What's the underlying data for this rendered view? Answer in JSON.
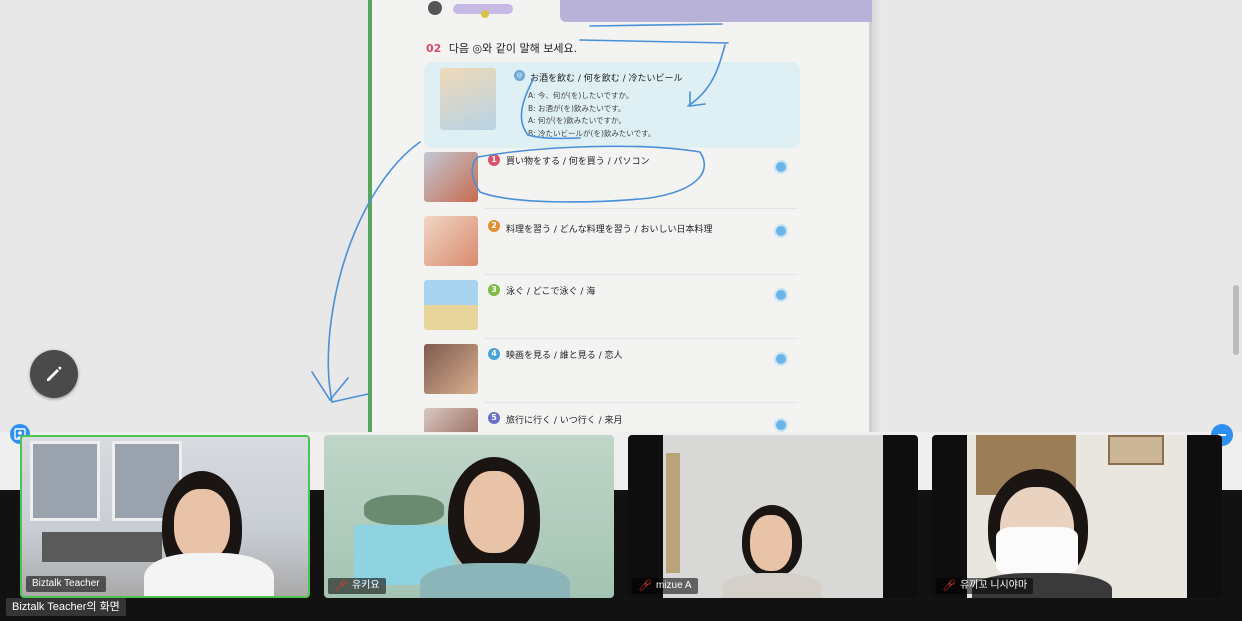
{
  "shared_screen": {
    "exercise": {
      "number": "02",
      "instruction": "다음 ◎와 같이 말해 보세요.",
      "example": {
        "marker": "◎",
        "prompt": "お酒を飲む / 何を飲む / 冷たいビール",
        "lines": [
          "A: 今、何が(を)したいですか。",
          "B: お酒が(を)飲みたいです。",
          "A: 何が(を)飲みたいですか。",
          "B: 冷たいビールが(を)飲みたいです。"
        ]
      },
      "items": [
        {
          "num": "1",
          "text": "買い物をする / 何を買う / パソコン"
        },
        {
          "num": "2",
          "text": "料理を習う / どんな料理を習う / おいしい日本料理"
        },
        {
          "num": "3",
          "text": "泳ぐ / どこで泳ぐ / 海"
        },
        {
          "num": "4",
          "text": "映画を見る / 誰と見る / 恋人"
        },
        {
          "num": "5",
          "text": "旅行に行く / いつ行く / 来月"
        }
      ]
    },
    "accent_colors": {
      "green_border": "#58a65c",
      "example_bg": "#dff0f4",
      "annotation": "#4a8fd8",
      "active_speaker": "#4cc54e"
    }
  },
  "tools": {
    "pencil_icon": "pencil-icon"
  },
  "participants": [
    {
      "name": "Biztalk Teacher",
      "muted": false,
      "active": true
    },
    {
      "name": "유키요",
      "muted": true,
      "active": false
    },
    {
      "name": "mizue A",
      "muted": true,
      "active": false
    },
    {
      "name": "유끼꼬 니시야마",
      "muted": true,
      "active": false
    }
  ],
  "share_label": "Biztalk Teacher의 화면",
  "icons": {
    "view_left": "gallery-view-icon",
    "view_right": "minimize-icon",
    "mute": "mic-muted-icon"
  }
}
